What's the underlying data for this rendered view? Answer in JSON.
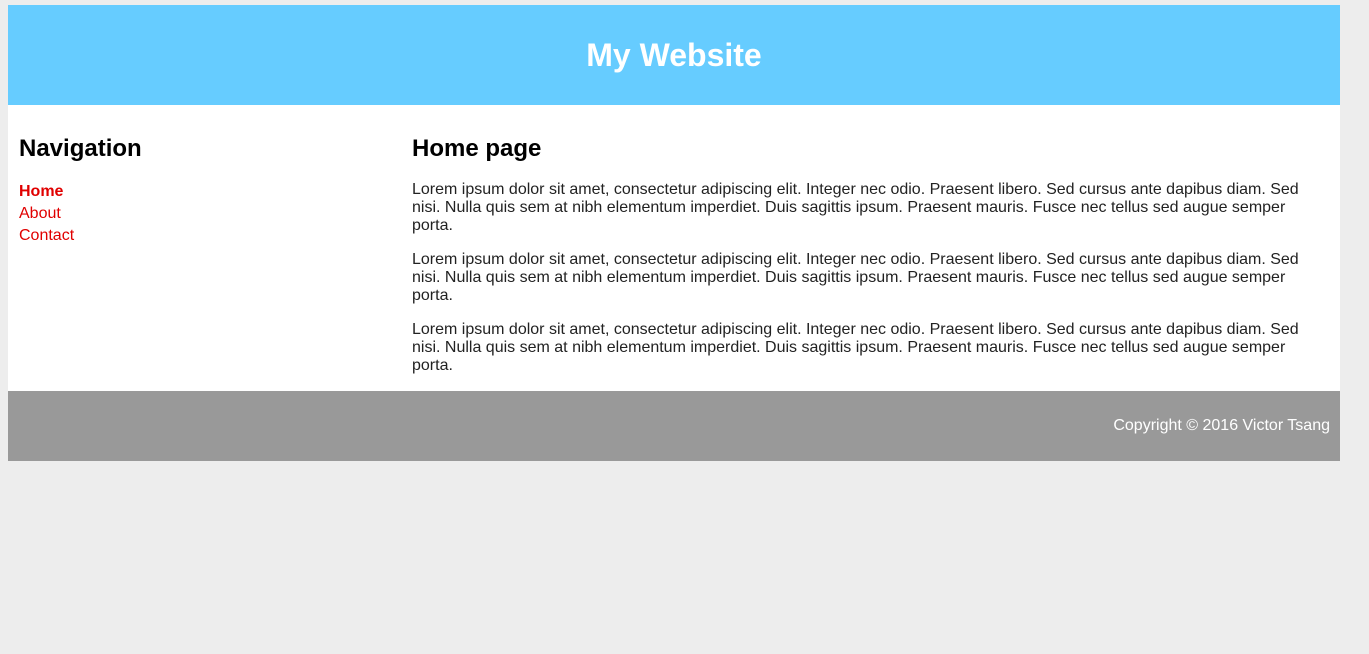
{
  "header": {
    "title": "My Website"
  },
  "sidebar": {
    "heading": "Navigation",
    "items": [
      {
        "label": "Home",
        "active": true
      },
      {
        "label": "About",
        "active": false
      },
      {
        "label": "Contact",
        "active": false
      }
    ]
  },
  "main": {
    "heading": "Home page",
    "paragraphs": [
      "Lorem ipsum dolor sit amet, consectetur adipiscing elit. Integer nec odio. Praesent libero. Sed cursus ante dapibus diam. Sed nisi. Nulla quis sem at nibh elementum imperdiet. Duis sagittis ipsum. Praesent mauris. Fusce nec tellus sed augue semper porta.",
      "Lorem ipsum dolor sit amet, consectetur adipiscing elit. Integer nec odio. Praesent libero. Sed cursus ante dapibus diam. Sed nisi. Nulla quis sem at nibh elementum imperdiet. Duis sagittis ipsum. Praesent mauris. Fusce nec tellus sed augue semper porta.",
      "Lorem ipsum dolor sit amet, consectetur adipiscing elit. Integer nec odio. Praesent libero. Sed cursus ante dapibus diam. Sed nisi. Nulla quis sem at nibh elementum imperdiet. Duis sagittis ipsum. Praesent mauris. Fusce nec tellus sed augue semper porta."
    ]
  },
  "footer": {
    "copyright": "Copyright © 2016 Victor Tsang"
  },
  "colors": {
    "header_bg": "#66ccff",
    "footer_bg": "#999999",
    "link": "#e00000",
    "page_bg": "#ededed"
  }
}
